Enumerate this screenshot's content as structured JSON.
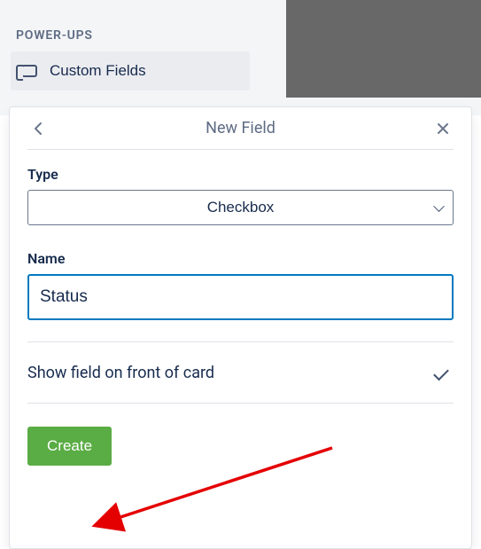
{
  "section": {
    "title": "POWER-UPS"
  },
  "powerup": {
    "name": "Custom Fields"
  },
  "popover": {
    "title": "New Field",
    "typeLabel": "Type",
    "typeValue": "Checkbox",
    "nameLabel": "Name",
    "nameValue": "Status",
    "showFrontLabel": "Show field on front of card",
    "showFrontChecked": true,
    "createLabel": "Create"
  }
}
